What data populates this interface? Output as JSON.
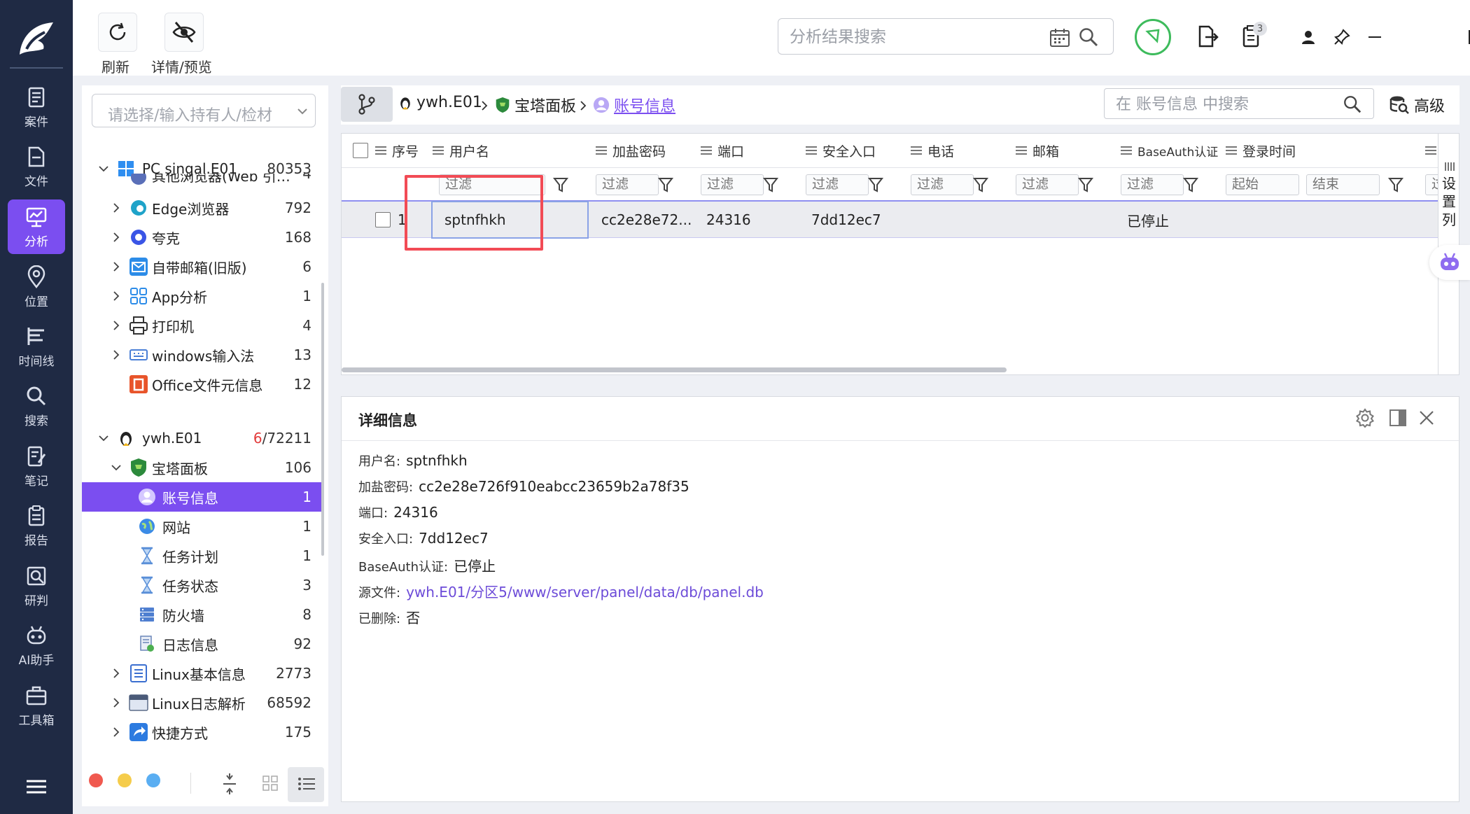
{
  "colors": {
    "accent": "#7b4ef0",
    "nav_bg": "#1f2a44",
    "highlight_box": "#f24b55",
    "link": "#6c4bd8"
  },
  "nav": {
    "items": [
      {
        "label": "案件",
        "icon": "case-icon"
      },
      {
        "label": "文件",
        "icon": "file-icon"
      },
      {
        "label": "分析",
        "icon": "analysis-icon",
        "active": true
      },
      {
        "label": "位置",
        "icon": "location-icon"
      },
      {
        "label": "时间线",
        "icon": "timeline-icon"
      },
      {
        "label": "搜索",
        "icon": "search-icon"
      },
      {
        "label": "笔记",
        "icon": "note-icon"
      },
      {
        "label": "报告",
        "icon": "report-icon"
      },
      {
        "label": "研判",
        "icon": "judge-icon"
      },
      {
        "label": "AI助手",
        "icon": "ai-assistant-icon"
      },
      {
        "label": "工具箱",
        "icon": "toolbox-icon"
      }
    ]
  },
  "toolbar": {
    "refresh_label": "刷新",
    "detail_preview_label": "详情/预览"
  },
  "top_search": {
    "placeholder": "分析结果搜索"
  },
  "top_badge": "3",
  "tree": {
    "select_placeholder": "请选择/输入持有人/检材",
    "rows": [
      {
        "label": "PC singal.E01",
        "count": "80353"
      },
      {
        "label": "其他浏览器(Web 引…",
        "count": "4"
      },
      {
        "label": "Edge浏览器",
        "count": "792"
      },
      {
        "label": "夸克",
        "count": "168"
      },
      {
        "label": "自带邮箱(旧版)",
        "count": "6"
      },
      {
        "label": "App分析",
        "count": "1"
      },
      {
        "label": "打印机",
        "count": "4"
      },
      {
        "label": "windows输入法",
        "count": "13"
      },
      {
        "label": "Office文件元信息",
        "count": "12"
      },
      {
        "label": "ywh.E01",
        "count_red": "6",
        "count": "/72211"
      },
      {
        "label": "宝塔面板",
        "count": "106"
      },
      {
        "label": "账号信息",
        "count": "1"
      },
      {
        "label": "网站",
        "count": "1"
      },
      {
        "label": "任务计划",
        "count": "1"
      },
      {
        "label": "任务状态",
        "count": "3"
      },
      {
        "label": "防火墙",
        "count": "8"
      },
      {
        "label": "日志信息",
        "count": "92"
      },
      {
        "label": "Linux基本信息",
        "count": "2773"
      },
      {
        "label": "Linux日志解析",
        "count": "68592"
      },
      {
        "label": "快捷方式",
        "count": "175"
      }
    ]
  },
  "breadcrumb": {
    "c1": "ywh.E01",
    "c2": "宝塔面板",
    "c3": "账号信息"
  },
  "table_search": {
    "placeholder": "在 账号信息 中搜索"
  },
  "advanced_label": "高级",
  "grid": {
    "headers": [
      "序号",
      "用户名",
      "加盐密码",
      "端口",
      "安全入口",
      "电话",
      "邮箱",
      "BaseAuth认证",
      "登录时间"
    ],
    "filter_placeholder": "过滤",
    "date_start": "起始",
    "date_end": "结束",
    "row": {
      "index": "1",
      "username": "sptnfhkh",
      "salted_password": "cc2e28e72...",
      "port": "24316",
      "security_entry": "7dd12ec7",
      "baseauth": "已停止"
    },
    "column_settings": "设置列"
  },
  "detail": {
    "title": "详细信息",
    "fields": [
      {
        "key": "用户名:",
        "value": "sptnfhkh"
      },
      {
        "key": "加盐密码:",
        "value": "cc2e28e726f910eabcc23659b2a78f35"
      },
      {
        "key": "端口:",
        "value": "24316"
      },
      {
        "key": "安全入口:",
        "value": "7dd12ec7"
      },
      {
        "key": "BaseAuth认证:",
        "value": "已停止"
      },
      {
        "key": "源文件:",
        "value": "ywh.E01/分区5/www/server/panel/data/db/panel.db",
        "link": true
      },
      {
        "key": "已删除:",
        "value": "否"
      }
    ]
  }
}
